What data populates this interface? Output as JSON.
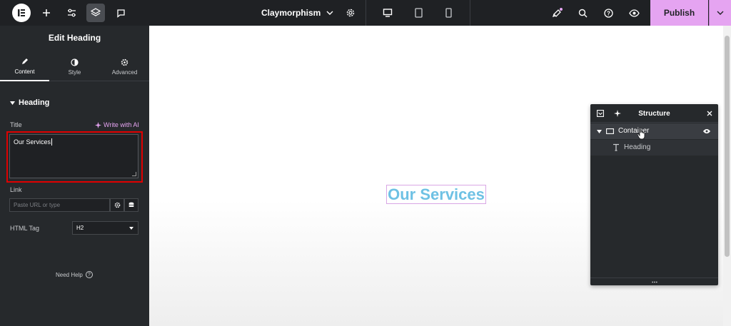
{
  "topbar": {
    "site_name": "Claymorphism",
    "publish_label": "Publish",
    "icons": [
      "elementor-logo-icon",
      "add-icon",
      "settings-sliders-icon",
      "layers-icon",
      "comments-icon",
      "chevron-down-icon",
      "gear-icon",
      "desktop-icon",
      "tablet-icon",
      "mobile-icon",
      "whats-new-icon",
      "search-icon",
      "help-icon",
      "preview-eye-icon"
    ]
  },
  "panel": {
    "title": "Edit Heading",
    "tabs": [
      {
        "label": "Content",
        "icon": "pencil-icon"
      },
      {
        "label": "Style",
        "icon": "half-circle-icon"
      },
      {
        "label": "Advanced",
        "icon": "gear-icon"
      }
    ],
    "section": "Heading",
    "title_label": "Title",
    "ai_label": "Write with AI",
    "title_value": "Our Services",
    "link_label": "Link",
    "link_placeholder": "Paste URL or type",
    "html_tag_label": "HTML Tag",
    "html_tag_value": "H2",
    "need_help": "Need Help"
  },
  "canvas": {
    "heading": "Our Services"
  },
  "structure": {
    "title": "Structure",
    "items": [
      {
        "label": "Container"
      },
      {
        "label": "Heading"
      }
    ]
  },
  "colors": {
    "accent": "#e5a4f1",
    "heading": "#6ec1e4",
    "panel_bg": "#26292c",
    "highlight": "#e00000"
  }
}
